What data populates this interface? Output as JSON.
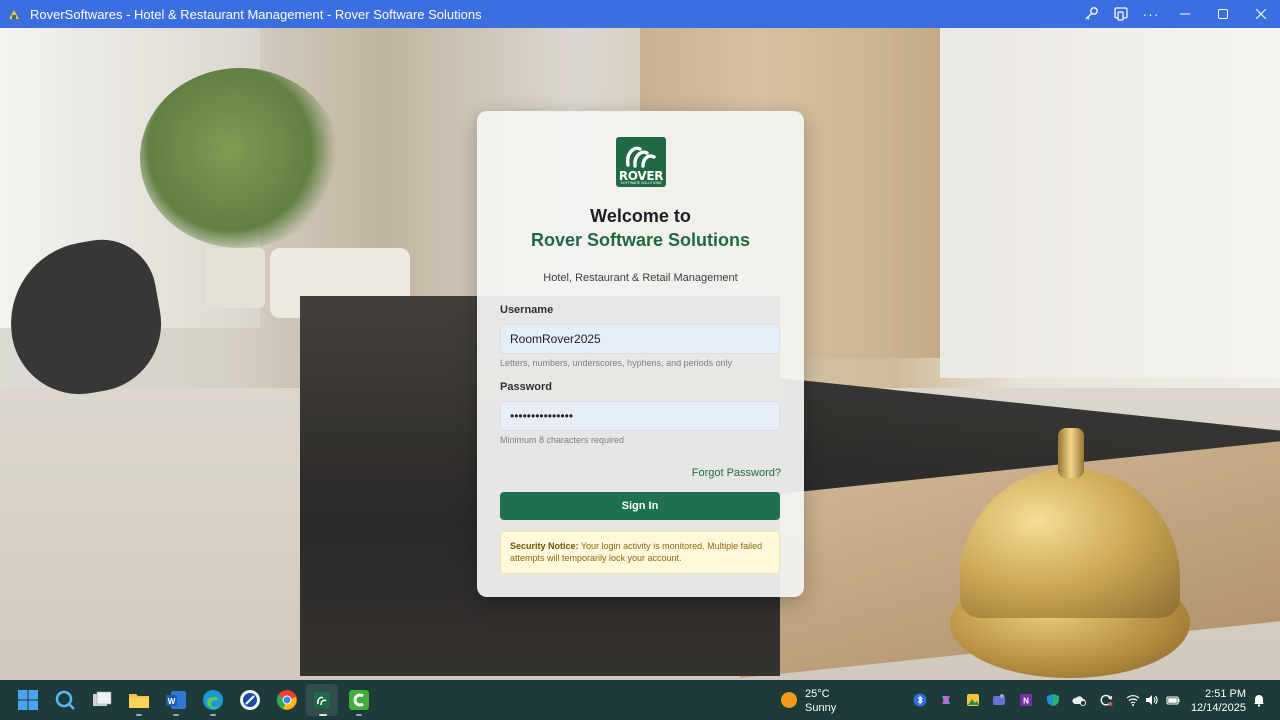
{
  "window": {
    "title": "RoverSoftwares - Hotel & Restaurant Management - Rover Software Solutions",
    "icons": [
      "app-icon",
      "key-icon",
      "cast-icon",
      "more-icon",
      "minimize-icon",
      "maximize-icon",
      "close-icon"
    ]
  },
  "login": {
    "logo_text": "ROVER",
    "logo_subtext": "SOFTWARE SOLUTIONS",
    "welcome": "Welcome to",
    "brand": "Rover Software Solutions",
    "tagline": "Hotel, Restaurant & Retail Management",
    "username_label": "Username",
    "username_value": "RoomRover2025",
    "username_help": "Letters, numbers, underscores, hyphens, and periods only",
    "password_label": "Password",
    "password_value": "•••••••••••••••",
    "password_help": "Minimum 8 characters required",
    "forgot_link": "Forgot Password?",
    "signin_label": "Sign In",
    "notice_title": "Security Notice:",
    "notice_text": " Your login activity is monitored. Multiple failed attempts will temporarily lock your account.",
    "colors": {
      "primary": "#1e7150",
      "notice_bg": "#fff8db"
    }
  },
  "taskbar": {
    "pinned": [
      "start-icon",
      "search-icon",
      "task-view-icon",
      "file-explorer-icon",
      "word-icon",
      "edge-icon",
      "shortcut-app-icon",
      "chrome-icon",
      "rover-app-icon",
      "camtasia-icon"
    ],
    "weather": {
      "temp": "25°C",
      "condition": "Sunny"
    },
    "tray": [
      "bluetooth-icon",
      "copilot-icon",
      "photos-icon",
      "teams-icon",
      "onenote-icon",
      "defender-icon",
      "onedrive-icon",
      "sync-icon",
      "wifi-icon",
      "volume-icon",
      "battery-icon"
    ],
    "time": "2:51 PM",
    "date": "12/14/2025"
  }
}
